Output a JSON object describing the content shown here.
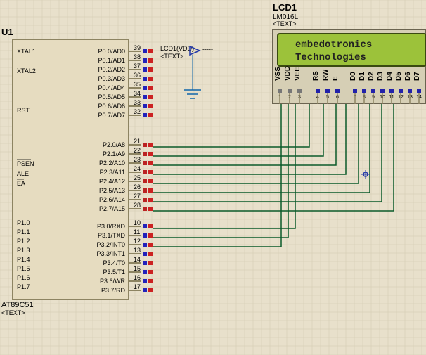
{
  "component_u1": {
    "ref": "U1",
    "part": "AT89C51",
    "text_marker": "<TEXT>",
    "pins_left": [
      {
        "label": "XTAL1"
      },
      {
        "label": ""
      },
      {
        "label": "XTAL2"
      },
      {
        "label": ""
      },
      {
        "label": ""
      },
      {
        "label": "RST"
      },
      {
        "label": ""
      },
      {
        "label": ""
      },
      {
        "label": "PSEN",
        "overline": true
      },
      {
        "label": "ALE"
      },
      {
        "label": "EA",
        "overline": true
      },
      {
        "label": ""
      },
      {
        "label": ""
      },
      {
        "label": "P1.0"
      },
      {
        "label": "P1.1"
      },
      {
        "label": "P1.2"
      },
      {
        "label": "P1.3"
      },
      {
        "label": "P1.4"
      },
      {
        "label": "P1.5"
      },
      {
        "label": "P1.6"
      },
      {
        "label": "P1.7"
      }
    ],
    "pins_right_group1": [
      {
        "num": "39",
        "label": "P0.0/AD0"
      },
      {
        "num": "38",
        "label": "P0.1/AD1"
      },
      {
        "num": "37",
        "label": "P0.2/AD2"
      },
      {
        "num": "36",
        "label": "P0.3/AD3"
      },
      {
        "num": "35",
        "label": "P0.4/AD4"
      },
      {
        "num": "34",
        "label": "P0.5/AD5"
      },
      {
        "num": "33",
        "label": "P0.6/AD6"
      },
      {
        "num": "32",
        "label": "P0.7/AD7"
      }
    ],
    "pins_right_group2": [
      {
        "num": "21",
        "label": "P2.0/A8"
      },
      {
        "num": "22",
        "label": "P2.1/A9"
      },
      {
        "num": "23",
        "label": "P2.2/A10"
      },
      {
        "num": "24",
        "label": "P2.3/A11"
      },
      {
        "num": "25",
        "label": "P2.4/A12"
      },
      {
        "num": "26",
        "label": "P2.5/A13"
      },
      {
        "num": "27",
        "label": "P2.6/A14"
      },
      {
        "num": "28",
        "label": "P2.7/A15"
      }
    ],
    "pins_right_group3": [
      {
        "num": "10",
        "label": "P3.0/RXD"
      },
      {
        "num": "11",
        "label": "P3.1/TXD"
      },
      {
        "num": "12",
        "label": "P3.2/INT0"
      },
      {
        "num": "13",
        "label": "P3.3/INT1"
      },
      {
        "num": "14",
        "label": "P3.4/T0"
      },
      {
        "num": "15",
        "label": "P3.5/T1"
      },
      {
        "num": "16",
        "label": "P3.6/WR"
      },
      {
        "num": "17",
        "label": "P3.7/RD"
      }
    ]
  },
  "component_lcd": {
    "ref": "LCD1",
    "part": "LM016L",
    "text_marker": "<TEXT>",
    "line1": "embedotronics",
    "line2": "Technologies",
    "pins": [
      "VSS",
      "VDD",
      "VEE",
      "RS",
      "RW",
      "E",
      "D0",
      "D1",
      "D2",
      "D3",
      "D4",
      "D5",
      "D6",
      "D7"
    ],
    "pin_nums": [
      "1",
      "2",
      "3",
      "4",
      "5",
      "6",
      "7",
      "8",
      "9",
      "10",
      "11",
      "12",
      "13",
      "14"
    ]
  },
  "probe": {
    "label": "LCD1(VDD)",
    "indicator": "-----",
    "text_marker": "<TEXT>"
  }
}
